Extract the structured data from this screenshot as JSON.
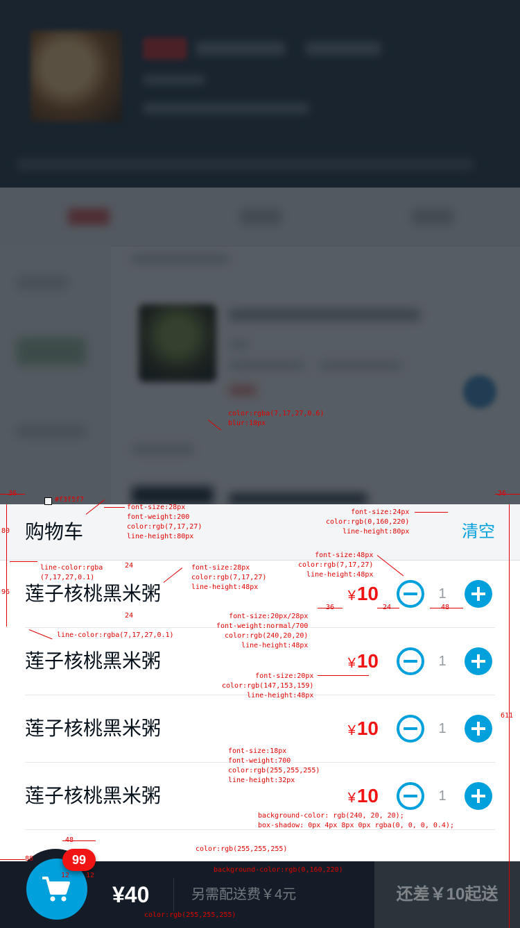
{
  "cart": {
    "title": "购物车",
    "clear_label": "清空",
    "items": [
      {
        "name": "莲子核桃黑米粥",
        "currency": "¥",
        "price": "10",
        "count": "1"
      },
      {
        "name": "莲子核桃黑米粥",
        "currency": "¥",
        "price": "10",
        "count": "1"
      },
      {
        "name": "莲子核桃黑米粥",
        "currency": "¥",
        "price": "10",
        "count": "1"
      },
      {
        "name": "莲子核桃黑米粥",
        "currency": "¥",
        "price": "10",
        "count": "1"
      }
    ]
  },
  "footer": {
    "badge_count": "99",
    "total_price": "¥40",
    "delivery_text": "另需配送费￥4元",
    "pay_label": "还差￥10起送"
  },
  "annotations": {
    "header_bg": "#f3f5f7",
    "title_spec": "font-size:28px\nfont-weight:200\ncolor:rgb(7,17,27)\nline-height:80px",
    "clear_spec": "font-size:24px\ncolor:rgb(0,160,220)\nline-height:80px",
    "line_spec_1": "line-color:rgba\n(7,17,27,0.1)",
    "line_spec_2": "line-color:rgba(7,17,27,0.1)",
    "name_spec": "font-size:28px\ncolor:rgb(7,17,27)\nline-height:48px",
    "button_spec": "font-size:48px\ncolor:rgb(7,17,27)\nline-height:48px",
    "price_spec": "font-size:20px/28px\nfont-weight:normal/700\ncolor:rgb(240,20,20)\nline-height:48px",
    "count_spec": "font-size:20px\ncolor:rgb(147,153,159)\nline-height:48px",
    "badge_spec": "font-size:18px\nfont-weight:700\ncolor:rgb(255,255,255)\nline-height:32px",
    "badge_bg_spec": "background-color: rgb(240, 20, 20);\nbox-shadow: 0px 4px 8px 0px rgba(0, 0, 0, 0.4);",
    "white_spec": "color:rgb(255,255,255)",
    "logo_bg_spec": "background-color:rgb(0,160,220)",
    "logo_icon_spec": "color:rgb(255,255,255)",
    "mask_spec": "color:rgba(7,17,27,0.6)\nblur:10px",
    "dim_36_left": "36",
    "dim_36_right": "36",
    "dim_80": "80",
    "dim_96": "96",
    "dim_24_top": "24",
    "dim_24_bottom": "24",
    "dim_36_price": "36",
    "dim_24_btn": "24",
    "dim_48_btn": "48",
    "dim_611": "611",
    "dim_48_badge": "48",
    "dim_88": "88",
    "dim_12_left": "12",
    "dim_12_right": "12"
  }
}
